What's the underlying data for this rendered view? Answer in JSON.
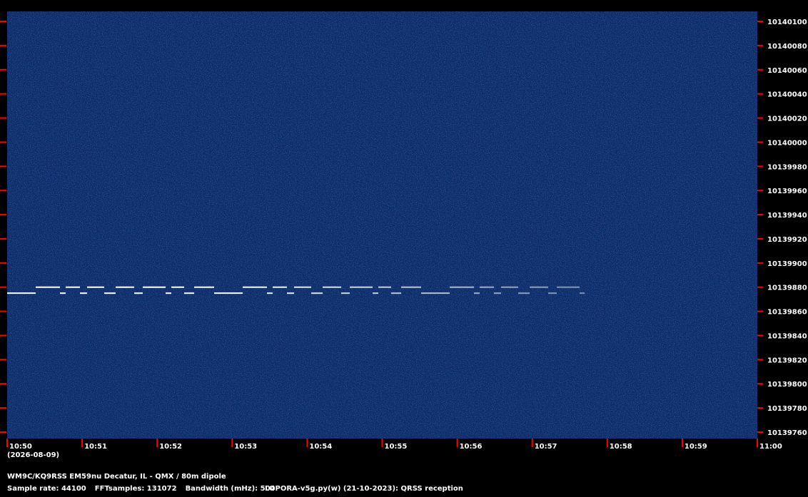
{
  "chart_data": {
    "type": "heatmap",
    "title": "",
    "x": {
      "ticks": [
        "10:50",
        "10:51",
        "10:52",
        "10:53",
        "10:54",
        "10:55",
        "10:56",
        "10:57",
        "10:58",
        "10:59",
        "11:00"
      ],
      "date": "(2026-08-09)",
      "start": "10:50",
      "end": "11:00"
    },
    "y": {
      "ticks": [
        10140100,
        10140080,
        10140060,
        10140040,
        10140020,
        10140000,
        10139980,
        10139960,
        10139940,
        10139920,
        10139900,
        10139880,
        10139860,
        10139840,
        10139820,
        10139800,
        10139780,
        10139760
      ],
      "ylim": [
        10139760,
        10140100
      ],
      "unit": "Hz"
    },
    "signal": {
      "base_freq": 10139875,
      "shift_freq": 10139880,
      "start_time": "10:50",
      "end_time": "10:57.7",
      "fade_from": "10:52.8"
    },
    "colors": {
      "background": "#0d2a66",
      "noise_light": "#1f4ea0",
      "signal": "#ffffff",
      "tick": "#ff0000"
    }
  },
  "footer": {
    "station": "WM9C/KQ9RSS EM59nu Decatur, IL - QMX / 80m dipole",
    "sample_rate": "Sample rate: 44100",
    "fft_samples": "FFTsamples: 131072",
    "bandwidth": "Bandwidth (mHz): 504",
    "software": "LOPORA-v5g.py(w) (21-10-2023): QRSS reception"
  }
}
